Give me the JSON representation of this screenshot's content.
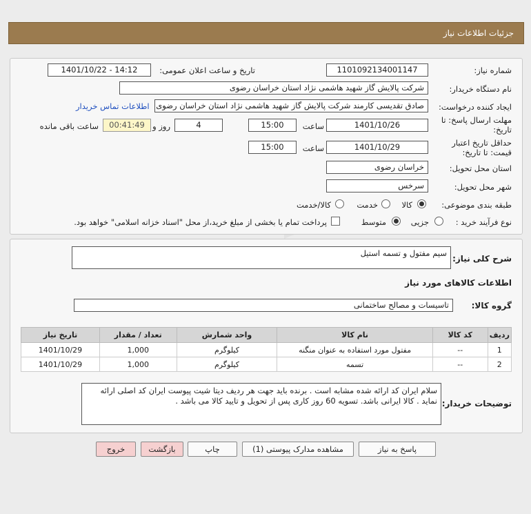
{
  "header": {
    "title": "جزئیات اطلاعات نیاز"
  },
  "form": {
    "need_number_label": "شماره نیاز:",
    "need_number": "1101092134001147",
    "announce_label": "تاریخ و ساعت اعلان عمومی:",
    "announce_value": "1401/10/22 - 14:12",
    "buyer_org_label": "نام دستگاه خریدار:",
    "buyer_org": "شرکت پالایش گاز شهید هاشمی نژاد   استان خراسان رضوی",
    "creator_label": "ایجاد کننده درخواست:",
    "creator": "صادق تقدیسی کارمند شرکت پالایش گاز شهید هاشمی نژاد   استان خراسان رضوی",
    "contact_link": "اطلاعات تماس خریدار",
    "deadline_label_1": "مهلت ارسال پاسخ: تا",
    "deadline_label_2": "تاریخ:",
    "deadline_date": "1401/10/26",
    "time_label": "ساعت",
    "deadline_time": "15:00",
    "days_value": "4",
    "days_label": "روز و",
    "remaining_value": "00:41:49",
    "remaining_label": "ساعت باقی مانده",
    "validity_label_1": "حداقل تاریخ اعتبار",
    "validity_label_2": "قیمت: تا تاریخ:",
    "validity_date": "1401/10/29",
    "validity_time": "15:00",
    "province_label": "استان محل تحویل:",
    "province": "خراسان رضوی",
    "city_label": "شهر محل تحویل:",
    "city": "سرخس",
    "category_label": "طبقه بندی موضوعی:",
    "category_options": [
      "کالا",
      "خدمت",
      "کالا/خدمت"
    ],
    "category_selected": "کالا",
    "process_label": "نوع فرآیند خرید :",
    "process_options": [
      "جزیی",
      "متوسط"
    ],
    "process_selected": "متوسط",
    "payment_note": "پرداخت تمام یا بخشی از مبلغ خرید،از محل \"اسناد خزانه اسلامی\" خواهد بود."
  },
  "details": {
    "general_desc_label": "شرح کلی نیاز:",
    "general_desc": "سیم مفتول و تسمه استیل",
    "goods_info_title": "اطلاعات کالاهای مورد نیاز",
    "goods_group_label": "گروه کالا:",
    "goods_group": "تاسیسات و مصالح ساختمانی",
    "table": {
      "headers": [
        "ردیف",
        "کد کالا",
        "نام کالا",
        "واحد شمارش",
        "تعداد / مقدار",
        "تاریخ نیاز"
      ],
      "rows": [
        [
          "1",
          "--",
          "مفتول مورد استفاده به عنوان منگنه",
          "کیلوگرم",
          "1,000",
          "1401/10/29"
        ],
        [
          "2",
          "--",
          "تسمه",
          "کیلوگرم",
          "1,000",
          "1401/10/29"
        ]
      ]
    },
    "buyer_desc_label": "توضیحات خریدار:",
    "buyer_desc": "سلام ایران کد ارائه شده مشابه است . برنده باید  جهت هر ردیف دیتا شیت پیوست ایران کد اصلی ارائه نماید . کالا ایرانی باشد. تسویه 60 روز کاری پس از تحویل و تایید کالا می باشد ."
  },
  "buttons": {
    "reply": "پاسخ به نیاز",
    "attachments": "مشاهده مدارک پیوستی (1)",
    "print": "چاپ",
    "back": "بازگشت",
    "exit": "خروج"
  },
  "watermark": {
    "line1": "ParsNamadData",
    "line2": "پایگاه اطلاع رسانی مناقصات و مزایده",
    "line3": "۰۲۱-۸۸۳۴۹۶۷۰",
    "line4": "۰۲۱-۸۸۳۴۹۶۷۰",
    "line5": "مرکز فراوری اطلاعات پارس نماد داده"
  }
}
